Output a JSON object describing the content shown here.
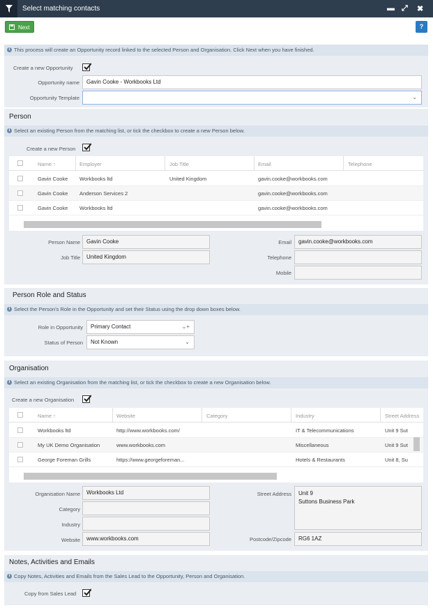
{
  "window": {
    "title": "Select matching contacts"
  },
  "toolbar": {
    "next_label": "Next",
    "help_label": "?"
  },
  "intro": {
    "info": "This process will create an Opportunity record linked to the selected Person and Organisation. Click Next when you have finished.",
    "create_opportunity_label": "Create a new Opportunity",
    "opportunity_name_label": "Opportunity name",
    "opportunity_name_value": "Gavin Cooke - Workbooks Ltd",
    "opportunity_template_label": "Opportunity Template",
    "opportunity_template_value": ""
  },
  "person": {
    "title": "Person",
    "info": "Select an existing Person from the matching list, or tick the checkbox to create a new Person below.",
    "create_label": "Create a new Person",
    "columns": [
      "Name",
      "Employer",
      "Job Title",
      "Email",
      "Telephone"
    ],
    "rows": [
      [
        "Gavin Cooke",
        "Workbooks ltd",
        "United Kingdom",
        "gavin.cooke@workbooks.com",
        ""
      ],
      [
        "Gavin Cooke",
        "Anderson Services 2",
        "",
        "gavin.cooke@workbooks.com",
        ""
      ],
      [
        "Gavin Cooke",
        "Workbooks ltd",
        "",
        "gavin.cooke@workbooks.com",
        ""
      ]
    ],
    "form": {
      "person_name_label": "Person Name",
      "person_name_value": "Gavin Cooke",
      "job_title_label": "Job Title",
      "job_title_value": "United Kingdom",
      "email_label": "Email",
      "email_value": "gavin.cooke@workbooks.com",
      "telephone_label": "Telephone",
      "telephone_value": "",
      "mobile_label": "Mobile",
      "mobile_value": ""
    }
  },
  "role": {
    "title": "Person Role and Status",
    "info": "Select the Person's Role in the Opportunity and set their Status using the drop down boxes below.",
    "role_label": "Role in Opportunity",
    "role_value": "Primary Contact",
    "status_label": "Status of Person",
    "status_value": "Not Known"
  },
  "organisation": {
    "title": "Organisation",
    "info": "Select an existing Organisation from the matching list, or tick the checkbox to create a new Organisation below.",
    "create_label": "Create a new Organisation",
    "columns": [
      "Name",
      "Website",
      "Category",
      "Industry",
      "Street Address"
    ],
    "rows": [
      [
        "Workbooks ltd",
        "http://www.workbooks.com/",
        "",
        "IT & Telecommunications",
        "Unit 9 Sut"
      ],
      [
        "My UK Demo Organisation",
        "www.workbooks.com",
        "",
        "Miscellaneous",
        "Unit 9 Sut"
      ],
      [
        "George Foreman Grills",
        "https://www.georgeforeman...",
        "",
        "Hotels & Restaurants",
        "Unit 8, Su"
      ]
    ],
    "form": {
      "org_name_label": "Organisation Name",
      "org_name_value": "Workbooks Ltd",
      "category_label": "Category",
      "category_value": "",
      "industry_label": "Industry",
      "industry_value": "",
      "website_label": "Website",
      "website_value": "www.workbooks.com",
      "street_label": "Street Address",
      "street_line1": "Unit 9",
      "street_line2": "Suttons Business Park",
      "postcode_label": "Postcode/Zipcode",
      "postcode_value": "RG6 1AZ"
    }
  },
  "notes": {
    "title": "Notes, Activities and Emails",
    "info": "Copy Notes, Activities and Emails from the Sales Lead to the Opportunity, Person and Organisation.",
    "copy_label": "Copy from Sales Lead"
  },
  "colors": {
    "titlebar": "#2f3e4f",
    "next_button": "#4aa14a",
    "help_button": "#2a7bc2",
    "panel": "#eaeef3",
    "info_bar": "#dbe3ec"
  }
}
